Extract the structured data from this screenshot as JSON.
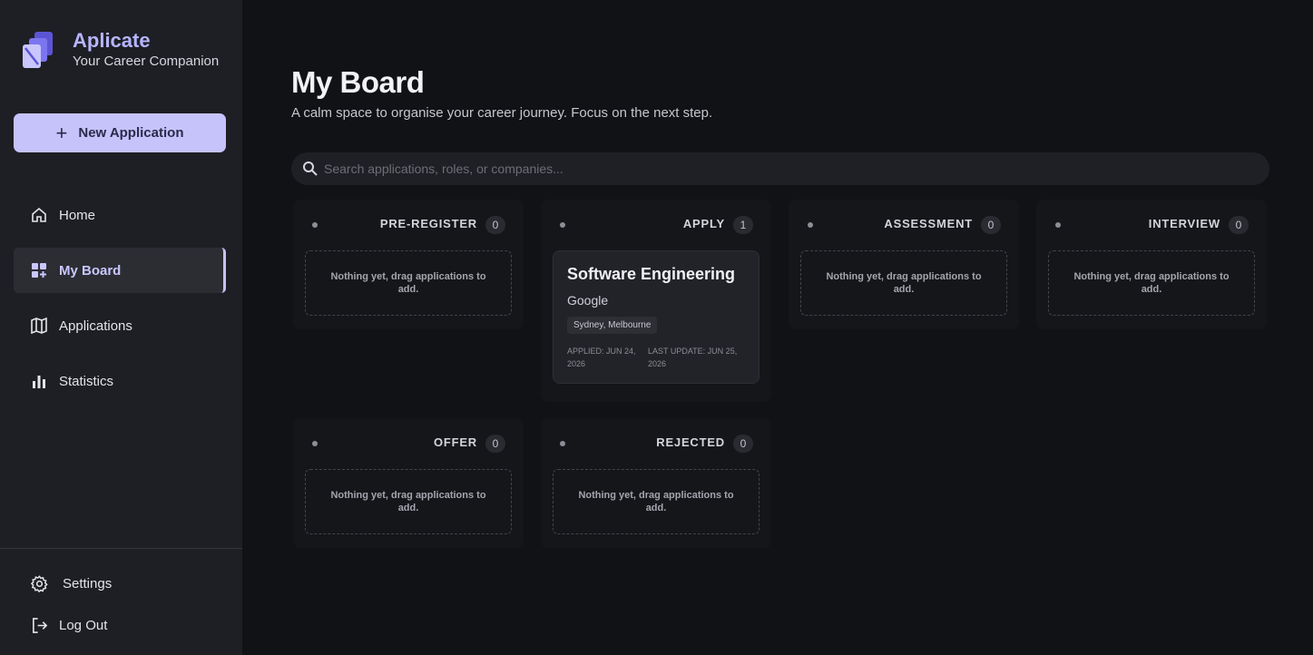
{
  "brand": {
    "name": "Aplicate",
    "tagline": "Your Career Companion"
  },
  "sidebar": {
    "new_button": "New Application",
    "items": [
      {
        "label": "Home",
        "icon": "home-icon"
      },
      {
        "label": "My Board",
        "icon": "board-icon",
        "active": true
      },
      {
        "label": "Applications",
        "icon": "map-icon"
      },
      {
        "label": "Statistics",
        "icon": "bar-chart-icon"
      }
    ],
    "settings": "Settings",
    "logout": "Log Out"
  },
  "main": {
    "title": "My Board",
    "subtitle": "A calm space to organise your career journey. Focus on the next step.",
    "search_placeholder": "Search applications, roles, or companies..."
  },
  "columns": [
    {
      "title": "PRE-REGISTER",
      "count": "0",
      "empty": "Nothing yet, drag applications to add."
    },
    {
      "title": "APPLY",
      "count": "1",
      "empty": ""
    },
    {
      "title": "ASSESSMENT",
      "count": "0",
      "empty": "Nothing yet, drag applications to add."
    },
    {
      "title": "INTERVIEW",
      "count": "0",
      "empty": "Nothing yet, drag applications to add."
    },
    {
      "title": "OFFER",
      "count": "0",
      "empty": "Nothing yet, drag applications to add."
    },
    {
      "title": "REJECTED",
      "count": "0",
      "empty": "Nothing yet, drag applications to add."
    }
  ],
  "card": {
    "role": "Software Engineering",
    "company": "Google",
    "location": "Sydney, Melbourne",
    "applied": "APPLIED: JUN 24, 2026",
    "last_update": "LAST UPDATE: JUN 25, 2026"
  },
  "colors": {
    "accent": "#c6c3fb",
    "brand": "#b7b5ff",
    "sidebar_bg": "#1e1f24",
    "main_bg": "#111216"
  }
}
